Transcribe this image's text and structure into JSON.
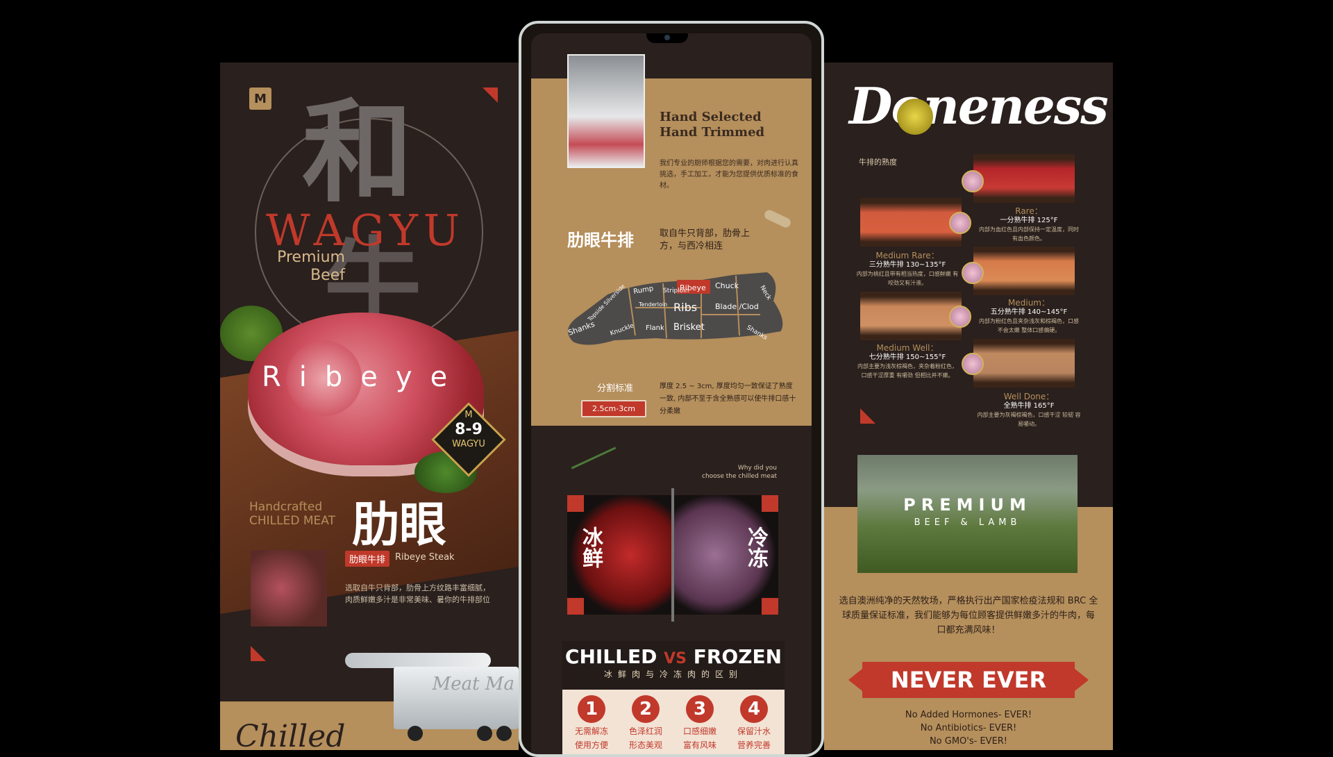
{
  "left": {
    "logo": "M",
    "kanji_top": "和",
    "kanji_bottom": "牛",
    "wagyu": "WAGYU",
    "premium": "Premium",
    "beef": "Beef",
    "ribeye": "Ribeye",
    "badge_top": "M",
    "badge_grade": "8-9",
    "badge_bottom": "WAGYU",
    "handcrafted": "Handcrafted",
    "chilled_meat": "CHILLED MEAT",
    "leiyan": "肋眼",
    "tag_cn": "肋眼牛排",
    "tag_en": "Ribeye Steak",
    "desc": "选取自牛只背部，肋骨上方纹路丰富细腻，肉质鲜嫩多汁是非常美味、暑你的牛排部位",
    "truck_text": "Meat Ma",
    "chilled_script": "Chilled"
  },
  "center": {
    "hand_title_1": "Hand Selected",
    "hand_title_2": "Hand Trimmed",
    "hand_desc": "我们专业的厨师根据您的需要，对肉进行认真挑选，手工加工，才能为您提供优质标准的食材。",
    "section_title": "肋眼牛排",
    "section_desc": "取自牛只背部，肋骨上方，与西冷相连",
    "cuts": [
      "Rump",
      "Striploin",
      "Ribeye",
      "Chuck",
      "Neck",
      "Topside Silverside",
      "Tenderloin",
      "Ribs",
      "Blade /Clod",
      "Knuckle",
      "Flank",
      "Brisket",
      "Shanks",
      "Shanks"
    ],
    "std_label": "分割标准",
    "std_badge": "2.5cm-3cm",
    "std_desc": "厚度 2.5 ~ 3cm, 厚度均匀一致保证了熟度一致, 内部不至于含全熟感可以使牛排口感十分柔嫩",
    "why_1": "Why did you",
    "why_2": "choose the chilled meat",
    "chilled_cn": "冰鲜",
    "frozen_cn": "冷冻",
    "cf_title_a": "CHILLED",
    "cf_vs": "VS",
    "cf_title_b": "FROZEN",
    "cf_sub": "冰鲜肉与冷冻肉的区别",
    "numbers": [
      {
        "n": "1",
        "t": "无需解冻",
        "t2": "使用方便"
      },
      {
        "n": "2",
        "t": "色泽红润",
        "t2": "形态美观"
      },
      {
        "n": "3",
        "t": "口感细嫩",
        "t2": "富有风味"
      },
      {
        "n": "4",
        "t": "保留汁水",
        "t2": "营养完善"
      }
    ]
  },
  "right": {
    "title": "Doneness",
    "subtitle": "牛排的熟度",
    "levels": [
      {
        "name": "Rare：",
        "temp": "一分熟牛排 125°F",
        "desc": "内部为血红色且内部保持一定温度，同时有血色颜色。"
      },
      {
        "name": "Medium Rare：",
        "temp": "三分熟牛排 130~135°F",
        "desc": "内部为桃红且带有相当热度，口感鲜嫩 有咬劲又有汁液。"
      },
      {
        "name": "Medium：",
        "temp": "五分熟牛排 140~145°F",
        "desc": "内部为粉红色且夹杂浅灰和棕褐色，口感不会太嫩 整体口感偏硬。"
      },
      {
        "name": "Medium Well：",
        "temp": "七分熟牛排 150~155°F",
        "desc": "内部主要为浅灰棕褐色，夹杂着粉红色，口感干涩厚重 有嚼劲 但相比并不嫩。"
      },
      {
        "name": "Well Done：",
        "temp": "全熟牛排 165°F",
        "desc": "内部主要为灰褐棕褐色，口感干涩 较韧 容易嚼动。"
      }
    ],
    "field_title": "PREMIUM",
    "field_sub": "BEEF & LAMB",
    "para": "选自澳洲纯净的天然牧场，严格执行出产国家检疫法规和 BRC 全球质量保证标准，我们能够为每位顾客提供鲜嫩多汁的牛肉，每口都充满风味！",
    "never": "NEVER EVER",
    "list": [
      "No Added Hormones- EVER!",
      "No Antibiotics- EVER!",
      "No GMO's- EVER!"
    ]
  },
  "colors": {
    "accent": "#c0392b",
    "tan": "#b58f5c",
    "dark": "#2a201d"
  }
}
